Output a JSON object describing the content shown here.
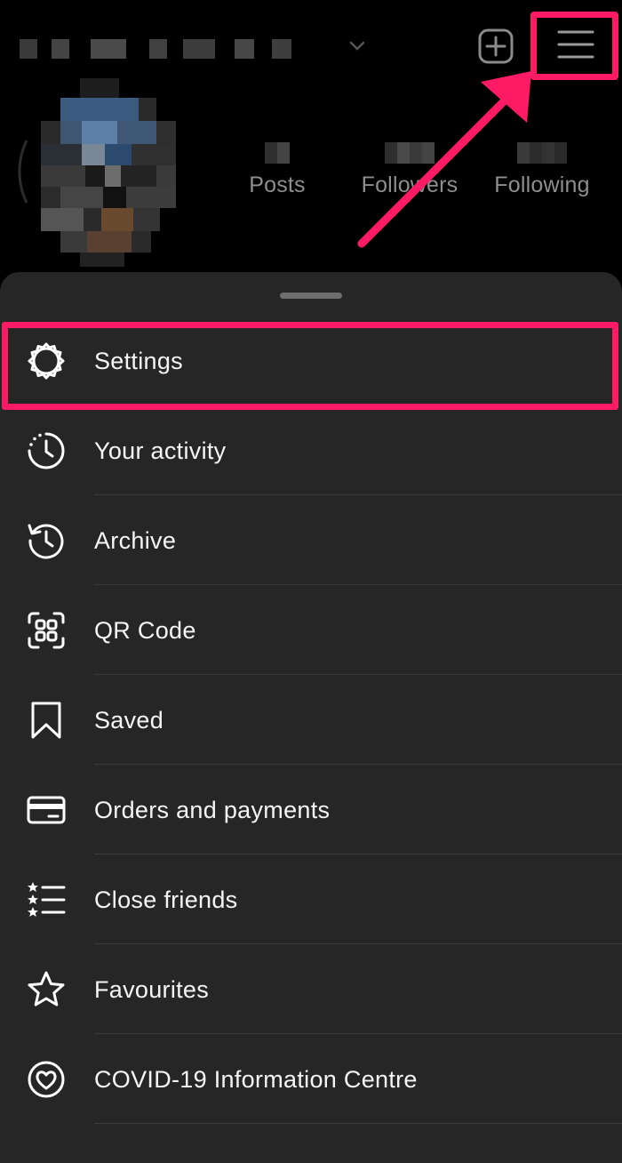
{
  "header": {
    "add_icon": "plus-square-icon",
    "menu_icon": "hamburger-menu-icon",
    "highlight_color": "#ff1a66"
  },
  "profile": {
    "stats": [
      {
        "label": "Posts"
      },
      {
        "label": "Followers"
      },
      {
        "label": "Following"
      }
    ]
  },
  "sheet": {
    "items": [
      {
        "label": "Settings",
        "icon": "gear-icon"
      },
      {
        "label": "Your activity",
        "icon": "activity-clock-icon"
      },
      {
        "label": "Archive",
        "icon": "archive-history-icon"
      },
      {
        "label": "QR Code",
        "icon": "qr-code-icon"
      },
      {
        "label": "Saved",
        "icon": "bookmark-icon"
      },
      {
        "label": "Orders and payments",
        "icon": "credit-card-icon"
      },
      {
        "label": "Close friends",
        "icon": "star-list-icon"
      },
      {
        "label": "Favourites",
        "icon": "star-icon"
      },
      {
        "label": "COVID-19 Information Centre",
        "icon": "heart-circle-icon"
      }
    ]
  }
}
